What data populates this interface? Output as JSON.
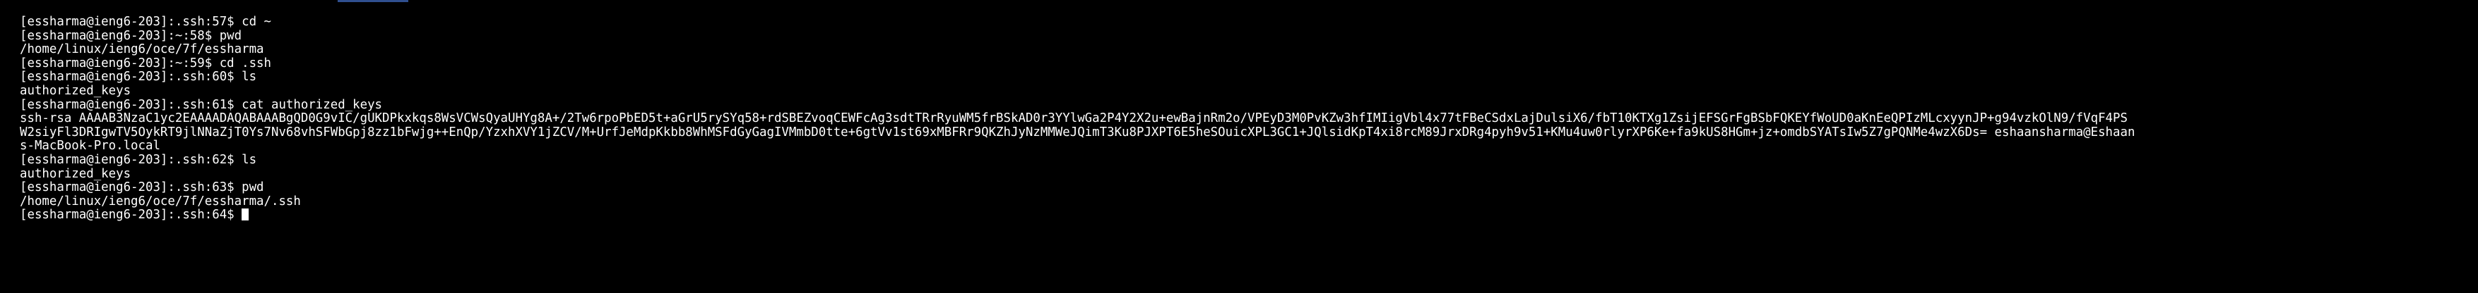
{
  "terminal": {
    "lines": [
      "[essharma@ieng6-203]:.ssh:57$ cd ~",
      "[essharma@ieng6-203]:~:58$ pwd",
      "/home/linux/ieng6/oce/7f/essharma",
      "[essharma@ieng6-203]:~:59$ cd .ssh",
      "[essharma@ieng6-203]:.ssh:60$ ls",
      "authorized_keys",
      "[essharma@ieng6-203]:.ssh:61$ cat authorized_keys",
      "ssh-rsa AAAAB3NzaC1yc2EAAAADAQABAAABgQD0G9vIC/gUKDPkxkqs8WsVCWsQyaUHYg8A+/2Tw6rpoPbED5t+aGrU5rySYq58+rdSBEZvoqCEWFcAg3sdtTRrRyuWM5frBSkAD0r3YYlwGa2P4Y2X2u+ewBajnRm2o/VPEyD3M0PvKZw3hfIMIigVbl4x77tFBeCSdxLajDulsiX6/fbT10KTXg1ZsijEFSGrFgBSbFQKEYfWoUD0aKnEeQPIzMLcxyynJP+g94vzkOlN9/fVqF4PS",
      "W2siyFl3DRIgwTV5OykRT9jlNNaZjT0Ys7Nv68vhSFWbGpj8zz1bFwjg++EnQp/YzxhXVY1jZCV/M+UrfJeMdpKkbb8WhMSFdGyGagIVMmbD0tte+6gtVv1st69xMBFRr9QKZhJyNzMMWeJQimT3Ku8PJXPT6E5heSOuicXPL3GC1+JQlsidKpT4xi8rcM89JrxDRg4pyh9v51+KMu4uw0rlyrXP6Ke+fa9kUS8HGm+jz+omdbSYATsIw5Z7gPQNMe4wzX6Ds= eshaansharma@Eshaan",
      "s-MacBook-Pro.local",
      "[essharma@ieng6-203]:.ssh:62$ ls",
      "authorized_keys",
      "[essharma@ieng6-203]:.ssh:63$ pwd",
      "/home/linux/ieng6/oce/7f/essharma/.ssh",
      "[essharma@ieng6-203]:.ssh:64$ "
    ]
  },
  "colors": {
    "background": "#000000",
    "foreground": "#ffffff",
    "cursor": "#ffffff"
  }
}
